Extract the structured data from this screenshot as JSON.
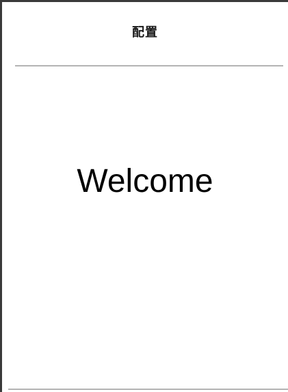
{
  "nav": {
    "title": "配置"
  },
  "main": {
    "welcome_text": "Welcome"
  }
}
